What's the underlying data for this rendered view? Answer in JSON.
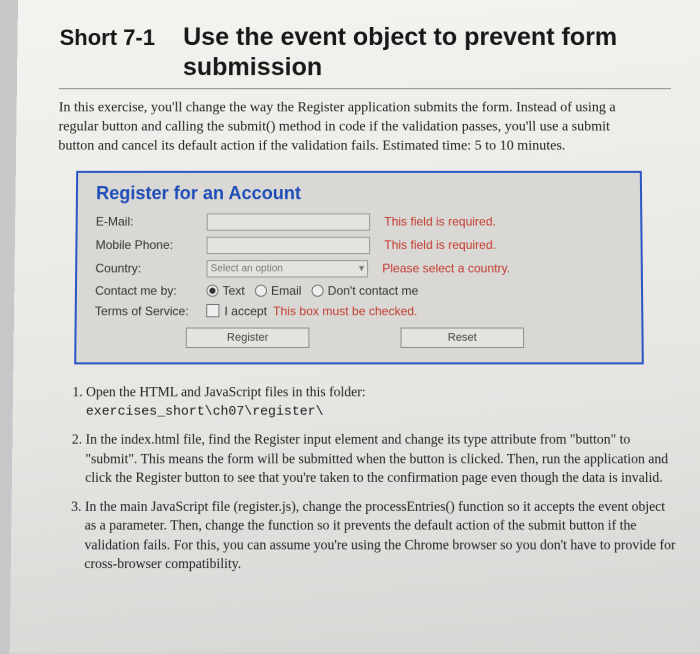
{
  "heading": {
    "short": "Short 7-1",
    "title": "Use the event object to prevent form submission"
  },
  "intro": "In this exercise, you'll change the way the Register application submits the form. Instead of using a regular button and calling the submit() method in code if the validation passes, you'll use a submit button and cancel its default action if the validation fails. Estimated time: 5 to 10 minutes.",
  "form": {
    "title": "Register for an Account",
    "email_label": "E-Mail:",
    "email_msg": "This field is required.",
    "phone_label": "Mobile Phone:",
    "phone_msg": "This field is required.",
    "country_label": "Country:",
    "country_placeholder": "Select an option",
    "country_msg": "Please select a country.",
    "contact_label": "Contact me by:",
    "contact_opts": {
      "text": "Text",
      "email": "Email",
      "none": "Don't contact me"
    },
    "tos_label": "Terms of Service:",
    "tos_text": "I accept",
    "tos_msg": "This box must be checked.",
    "register_btn": "Register",
    "reset_btn": "Reset"
  },
  "steps": {
    "s1": "Open the HTML and JavaScript files in this folder:",
    "s1_path": "exercises_short\\ch07\\register\\",
    "s2": "In the index.html file, find the Register input element and change its type attribute from \"button\" to \"submit\". This means the form will be submitted when the button is clicked. Then, run the application and click the Register button to see that you're taken to the confirmation page even though the data is invalid.",
    "s3": "In the main JavaScript file (register.js), change the processEntries() function so it accepts the event object as a parameter. Then, change the function so it prevents the default action of the submit button if the validation fails. For this, you can assume you're using the Chrome browser so you don't have to provide for cross-browser compatibility."
  }
}
